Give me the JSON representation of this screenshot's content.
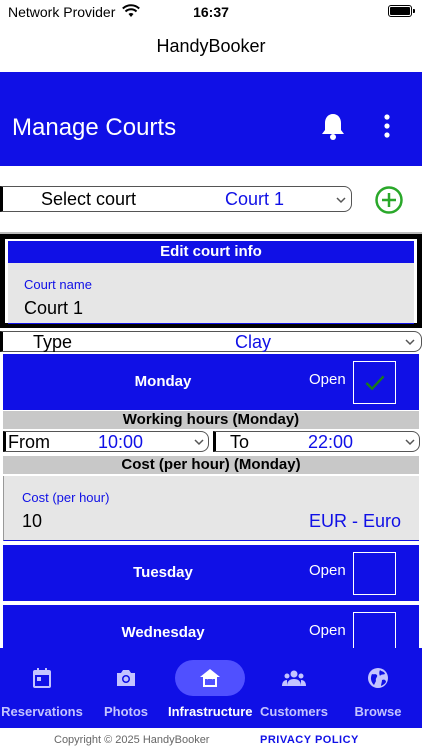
{
  "status_bar": {
    "carrier": "Network Provider",
    "time": "16:37"
  },
  "app_title": "HandyBooker",
  "header": {
    "title": "Manage Courts",
    "icons": [
      "bell-icon",
      "more-vertical-icon"
    ]
  },
  "court_select": {
    "label": "Select court",
    "value": "Court 1"
  },
  "edit_court": {
    "heading": "Edit court info",
    "court_name_label": "Court name",
    "court_name_value": "Court 1"
  },
  "type_select": {
    "label": "Type",
    "value": "Clay"
  },
  "days": [
    {
      "name": "Monday",
      "open_label": "Open",
      "open": true
    },
    {
      "name": "Tuesday",
      "open_label": "Open",
      "open": false
    },
    {
      "name": "Wednesday",
      "open_label": "Open",
      "open": false
    }
  ],
  "working_hours": {
    "heading": "Working hours (Monday)",
    "from_label": "From",
    "from_value": "10:00",
    "to_label": "To",
    "to_value": "22:00"
  },
  "cost": {
    "heading": "Cost (per hour) (Monday)",
    "label": "Cost (per hour)",
    "value": "10",
    "currency": "EUR - Euro"
  },
  "tabs": [
    {
      "label": "Reservations",
      "icon": "calendar-icon",
      "active": false
    },
    {
      "label": "Photos",
      "icon": "camera-icon",
      "active": false
    },
    {
      "label": "Infrastructure",
      "icon": "home-icon",
      "active": true
    },
    {
      "label": "Customers",
      "icon": "people-icon",
      "active": false
    },
    {
      "label": "Browse",
      "icon": "globe-icon",
      "active": false
    }
  ],
  "footer": {
    "copyright": "Copyright © 2025 HandyBooker",
    "privacy": "PRIVACY POLICY"
  },
  "colors": {
    "primary": "#1010e6",
    "check": "#1a7a1a",
    "add": "#2aa82a"
  }
}
